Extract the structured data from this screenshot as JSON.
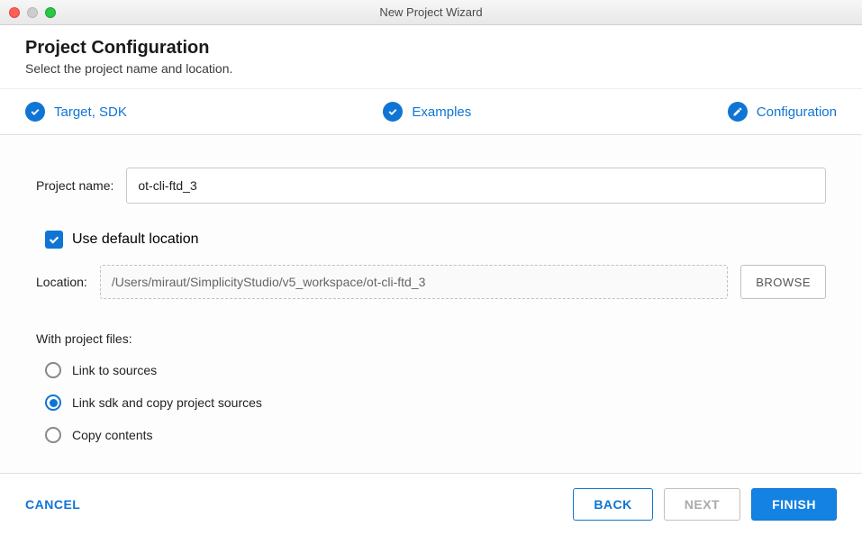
{
  "window": {
    "title": "New Project Wizard"
  },
  "header": {
    "title": "Project Configuration",
    "subtitle": "Select the project name and location."
  },
  "stepper": {
    "steps": [
      {
        "label": "Target, SDK",
        "icon": "check"
      },
      {
        "label": "Examples",
        "icon": "check"
      },
      {
        "label": "Configuration",
        "icon": "pencil"
      }
    ]
  },
  "form": {
    "project_name_label": "Project name:",
    "project_name_value": "ot-cli-ftd_3",
    "use_default_location_label": "Use default location",
    "use_default_location_checked": true,
    "location_label": "Location:",
    "location_value": "/Users/miraut/SimplicityStudio/v5_workspace/ot-cli-ftd_3",
    "browse_label": "BROWSE",
    "project_files_label": "With project files:",
    "radio_options": [
      {
        "label": "Link to sources",
        "selected": false
      },
      {
        "label": "Link sdk and copy project sources",
        "selected": true
      },
      {
        "label": "Copy contents",
        "selected": false
      }
    ]
  },
  "footer": {
    "cancel": "CANCEL",
    "back": "BACK",
    "next": "NEXT",
    "finish": "FINISH"
  }
}
